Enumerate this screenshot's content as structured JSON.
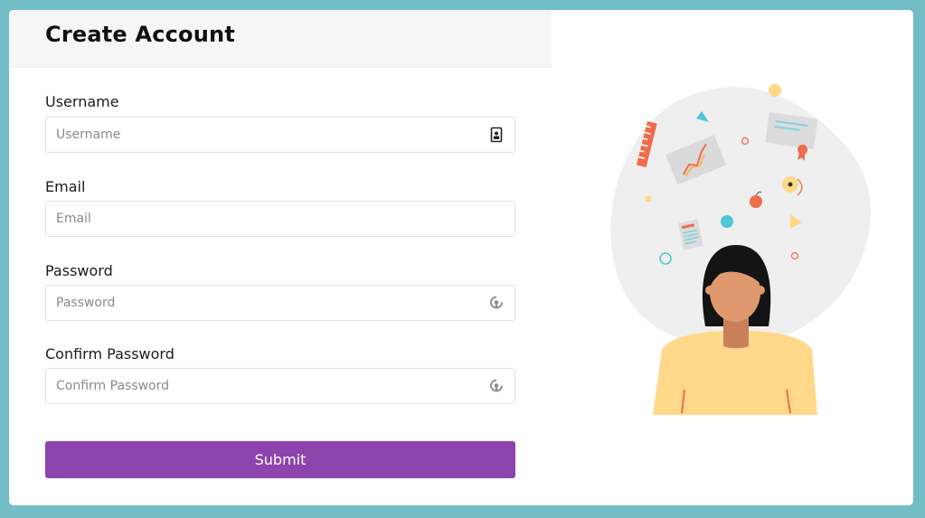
{
  "form": {
    "title": "Create Account",
    "fields": [
      {
        "label": "Username",
        "placeholder": "Username",
        "icon": "contact-card-icon"
      },
      {
        "label": "Email",
        "placeholder": "Email",
        "icon": ""
      },
      {
        "label": "Password",
        "placeholder": "Password",
        "icon": "password-eye-icon"
      },
      {
        "label": "Confirm Password",
        "placeholder": "Confirm Password",
        "icon": "password-eye-icon"
      }
    ],
    "submit_label": "Submit"
  },
  "colors": {
    "background": "#72bdc6",
    "accent": "#8e44ad",
    "header": "#f6f6f6"
  },
  "illustration": {
    "icon": "student-with-learning-items-illustration"
  }
}
